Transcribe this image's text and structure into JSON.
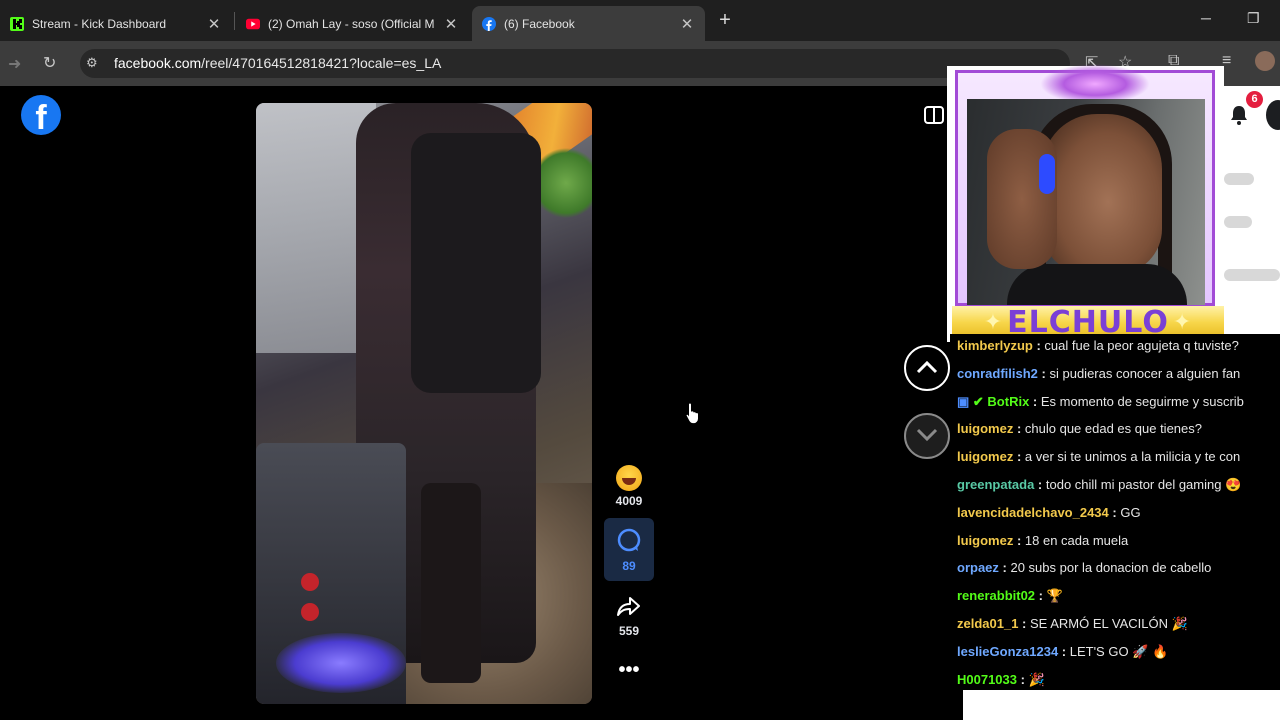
{
  "tabs": [
    {
      "title": "Stream - Kick Dashboard",
      "icon": "kick-logo-icon",
      "color": "#53fc18"
    },
    {
      "title": "(2) Omah Lay - soso (Official M",
      "icon": "youtube-logo-icon",
      "color": "#ff0033"
    },
    {
      "title": "(6) Facebook",
      "icon": "facebook-logo-icon",
      "color": "#1877f2",
      "active": true
    }
  ],
  "address_bar": {
    "host": "facebook.com",
    "path": "/reel/470164512818421?locale=es_LA"
  },
  "reel": {
    "reactions_count": "4009",
    "comments_count": "89",
    "shares_count": "559"
  },
  "notifications": {
    "badge": "6"
  },
  "overlay": {
    "streamer_name": "ELCHULO"
  },
  "chat": [
    {
      "user": "kimberlyzup",
      "text": "cual fue la peor agujeta q tuviste?",
      "color": "#f2c94c"
    },
    {
      "user": "conradfilish2",
      "text": "si pudieras conocer a alguien fan",
      "color": "#6fa8ff"
    },
    {
      "user": "BotRix",
      "text": "Es momento de seguirme y suscrib",
      "color": "#53fc18",
      "badges": [
        "bot-badge-icon",
        "verified-badge-icon"
      ]
    },
    {
      "user": "luigomez",
      "text": "chulo que edad es que tienes?",
      "color": "#f2c94c"
    },
    {
      "user": "luigomez",
      "text": "a ver si te unimos a la milicia y te con",
      "color": "#f2c94c"
    },
    {
      "user": "greenpatada",
      "text": "todo chill mi pastor del gaming 😍",
      "color": "#59c9a5"
    },
    {
      "user": "lavencidadelchavo_2434",
      "text": "GG",
      "color": "#f2c94c"
    },
    {
      "user": "luigomez",
      "text": "18 en cada muela",
      "color": "#f2c94c"
    },
    {
      "user": "orpaez",
      "text": "20 subs por la donacion de cabello",
      "color": "#6fa8ff"
    },
    {
      "user": "renerabbit02",
      "text": "🏆",
      "color": "#53fc18"
    },
    {
      "user": "zelda01_1",
      "text": "SE ARMÓ EL VACILÓN 🎉",
      "color": "#f2c94c"
    },
    {
      "user": "leslieGonza1234",
      "text": "LET'S GO 🚀 🔥",
      "color": "#6fa8ff"
    },
    {
      "user": "H0071033",
      "text": "🎉",
      "color": "#53fc18"
    }
  ]
}
